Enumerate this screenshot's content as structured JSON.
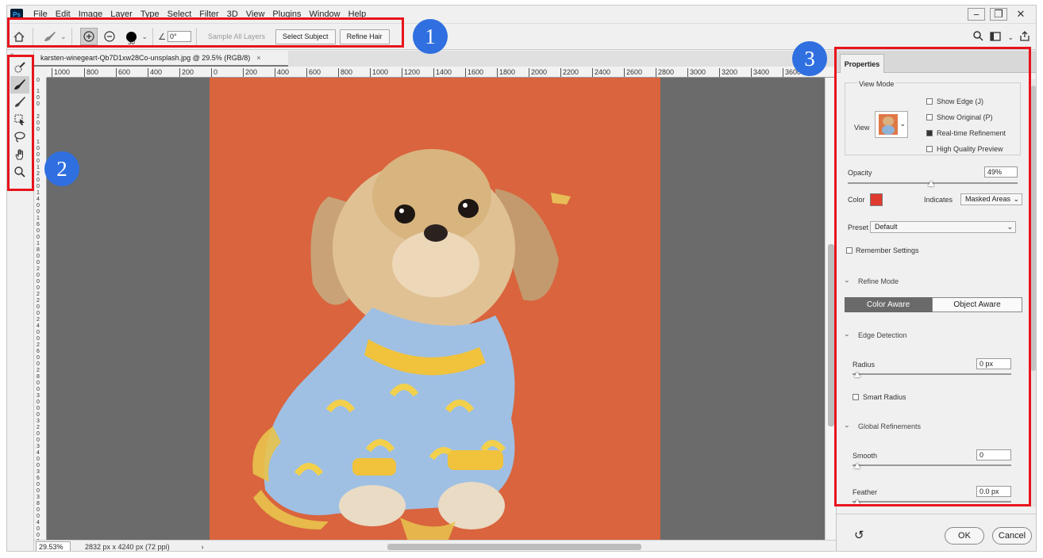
{
  "app": {
    "logo": "Ps",
    "menu": [
      "File",
      "Edit",
      "Image",
      "Layer",
      "Type",
      "Select",
      "Filter",
      "3D",
      "View",
      "Plugins",
      "Window",
      "Help"
    ],
    "window_controls": [
      "minimize-icon",
      "restore-icon",
      "close-icon"
    ]
  },
  "options_bar": {
    "brush_size": "30",
    "angle": "0°",
    "sample_all_layers": "Sample All Layers",
    "select_subject": "Select Subject",
    "refine_hair": "Refine Hair"
  },
  "annotations": {
    "badge1": "1",
    "badge2": "2",
    "badge3": "3",
    "color": "#e8141c",
    "badge_color": "#2f6fe0"
  },
  "document": {
    "tab_title": "karsten-winegeart-Qb7D1xw28Co-unsplash.jpg @ 29.5% (RGB/8)",
    "close": "×",
    "ruler_h": [
      "1000",
      "800",
      "600",
      "400",
      "200",
      "0",
      "200",
      "400",
      "600",
      "800",
      "1000",
      "1200",
      "1400",
      "1600",
      "1800",
      "2000",
      "2200",
      "2400",
      "2600",
      "2800",
      "3000",
      "3200",
      "3400",
      "3600"
    ],
    "ruler_v": [
      "0",
      "1 0 0",
      "2 0 0",
      "1 0 0 0",
      "1 2 0 0",
      "1 4 0 0",
      "1 6 0 0",
      "1 8 0 0",
      "2 0 0 0",
      "2 2 0 0",
      "2 4 0 0",
      "2 6 0 0",
      "2 8 0 0",
      "3 0 0 0",
      "3 2 0 0",
      "3 4 0 0",
      "3 6 0 0",
      "3 8 0 0",
      "4 0 0 0"
    ],
    "zoom": "29.53%",
    "doc_info": "2832 px x 4240 px (72 ppi)",
    "arrow": "›",
    "background_color": "#d9643d"
  },
  "properties": {
    "tab": "Properties",
    "view_mode": {
      "title": "View Mode",
      "view_label": "View",
      "show_edge": "Show Edge (J)",
      "show_original": "Show Original (P)",
      "realtime": "Real-time Refinement",
      "high_quality": "High Quality Preview",
      "show_edge_checked": false,
      "show_original_checked": false,
      "realtime_checked": true,
      "high_quality_checked": false
    },
    "opacity_label": "Opacity",
    "opacity_value": "49%",
    "opacity_level": 0.49,
    "color_label": "Color",
    "overlay_color": "#e03a2e",
    "indicates_label": "Indicates",
    "indicates_value": "Masked Areas",
    "preset_label": "Preset",
    "preset_value": "Default",
    "remember": "Remember Settings",
    "refine_mode": "Refine Mode",
    "color_aware": "Color Aware",
    "object_aware": "Object Aware",
    "edge_detection": "Edge Detection",
    "radius_label": "Radius",
    "radius_value": "0 px",
    "smart_radius": "Smart Radius",
    "global_refinements": "Global Refinements",
    "smooth_label": "Smooth",
    "smooth_value": "0",
    "feather_label": "Feather",
    "feather_value": "0.0 px",
    "ok": "OK",
    "cancel": "Cancel"
  }
}
